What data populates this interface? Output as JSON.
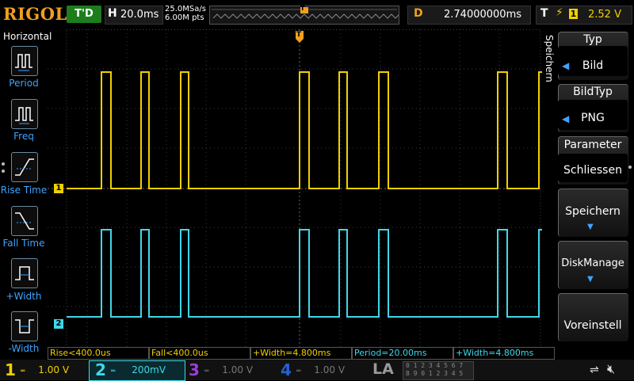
{
  "brand": "RIGOL",
  "status": "T'D",
  "timebase": {
    "label": "H",
    "value": "20.0ms",
    "sample_rate": "25.0MSa/s",
    "mem_depth": "6.00M pts"
  },
  "delay": {
    "label": "D",
    "value": "2.74000000ms"
  },
  "trigger": {
    "label": "T",
    "source": "1",
    "level": "2.52 V",
    "marker": "T"
  },
  "left_menu": {
    "title": "Horizontal",
    "items": [
      {
        "label": "Period",
        "icon": "period-icon"
      },
      {
        "label": "Freq",
        "icon": "freq-icon"
      },
      {
        "label": "Rise Time",
        "icon": "rise-time-icon"
      },
      {
        "label": "Fall Time",
        "icon": "fall-time-icon"
      },
      {
        "label": "+Width",
        "icon": "pos-width-icon"
      },
      {
        "label": "-Width",
        "icon": "neg-width-icon"
      }
    ]
  },
  "right_menu": {
    "side_label": "Speichern",
    "typ": {
      "title": "Typ",
      "value": "Bild"
    },
    "bildtyp": {
      "title": "BildTyp",
      "value": "PNG"
    },
    "parameter": {
      "title": "Parameter",
      "value": "Schliessen"
    },
    "speichern": {
      "label": "Speichern"
    },
    "diskmanage": {
      "label": "DiskManage"
    },
    "voreinstell": {
      "label": "Voreinstell"
    }
  },
  "waveform_markers": {
    "ch1": "1",
    "ch2": "2"
  },
  "measurements": [
    {
      "text": "Rise<400.0us",
      "color": "#f0d000"
    },
    {
      "text": "Fall<400.0us",
      "color": "#f0d000"
    },
    {
      "text": "+Width=4.800ms",
      "color": "#f0d000"
    },
    {
      "text": "Period=20.00ms",
      "color": "#3fd8e8"
    },
    {
      "text": "+Width=4.800ms",
      "color": "#3fd8e8"
    }
  ],
  "channels": [
    {
      "num": "1",
      "scale": "1.00 V",
      "color": "#f0d000",
      "active": true
    },
    {
      "num": "2",
      "scale": "200mV",
      "color": "#3fd8e8",
      "active": true
    },
    {
      "num": "3",
      "scale": "1.00 V",
      "color": "#9b3dd6",
      "active": false
    },
    {
      "num": "4",
      "scale": "1.00 V",
      "color": "#2a5fd0",
      "active": false
    }
  ],
  "la": {
    "label": "LA",
    "digits_top": "0 1 2 3  4 5 6 7",
    "digits_bottom": "8 9 0 1  2 3 4 5"
  },
  "colors": {
    "ch1": "#f0d000",
    "ch2": "#3fd8e8",
    "accent": "#f0a020",
    "menu_text": "#3fa3ff"
  }
}
